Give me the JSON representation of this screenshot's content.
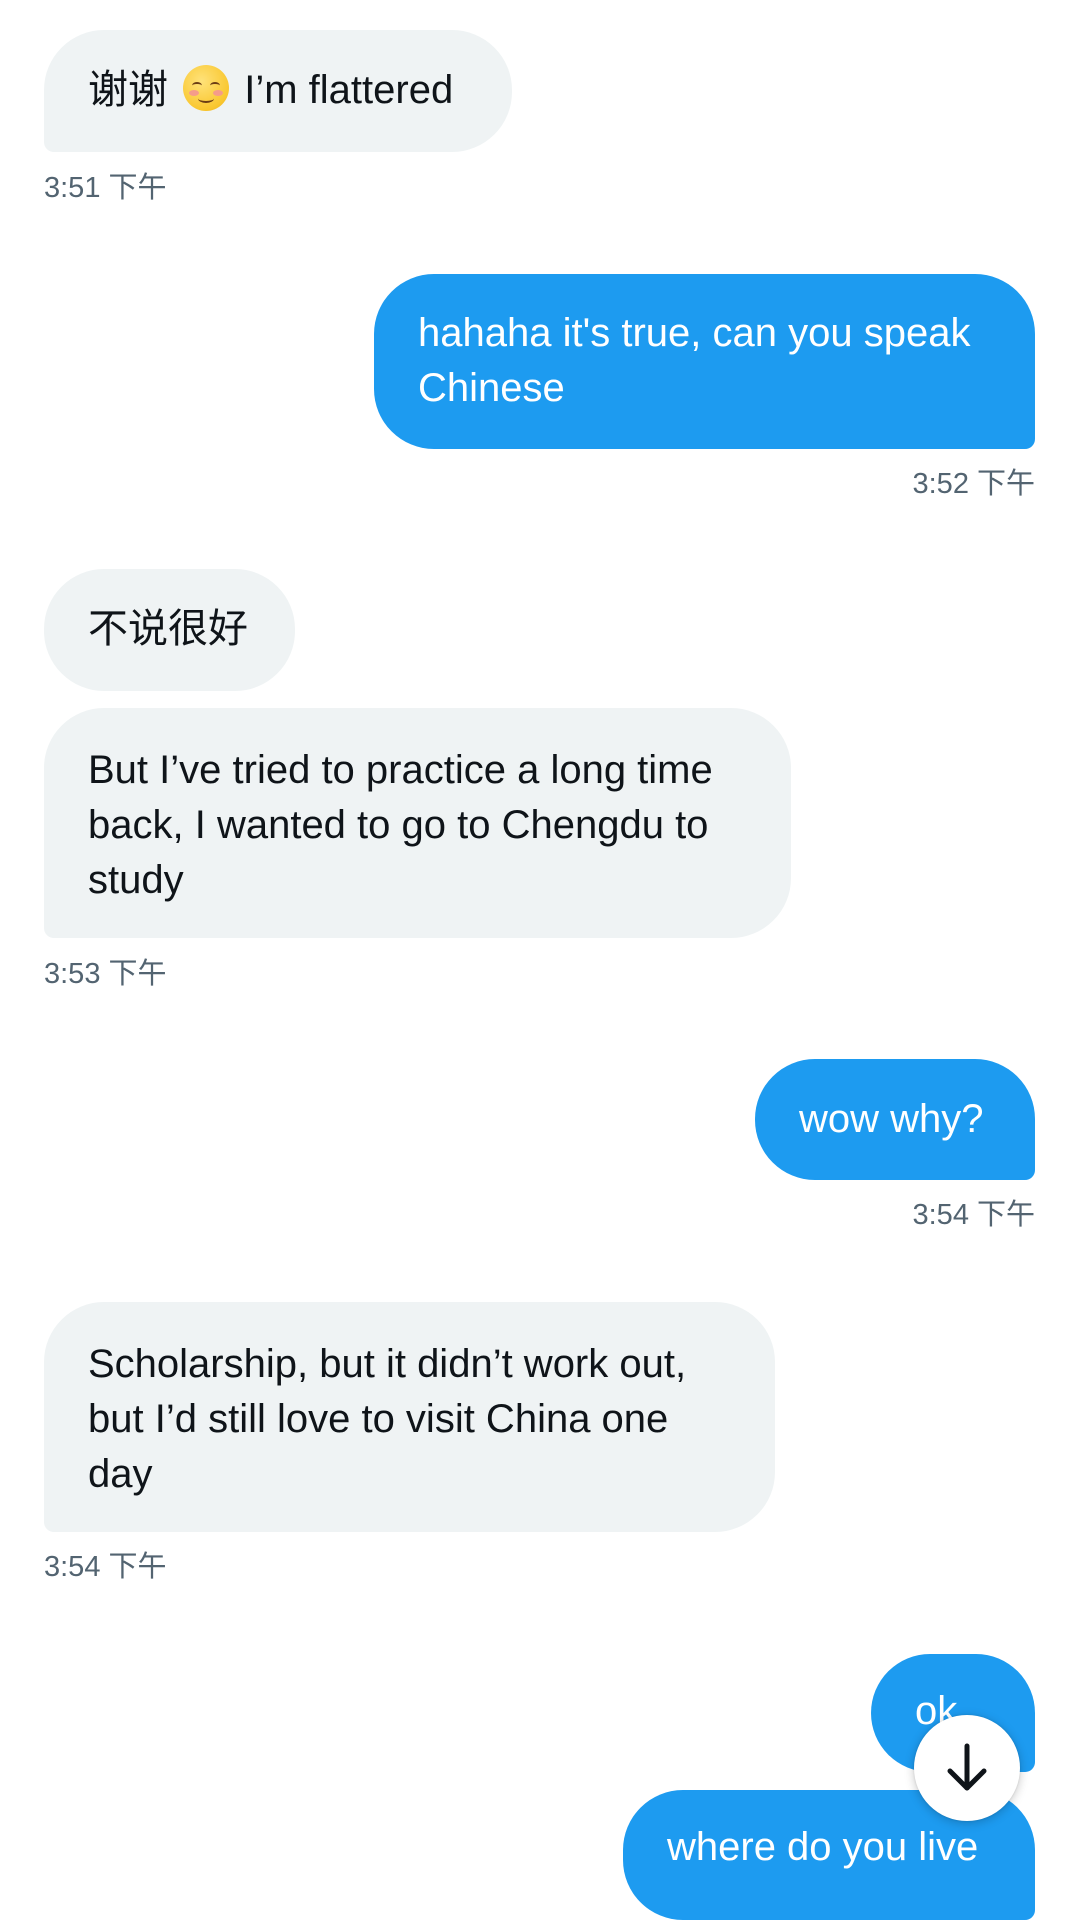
{
  "messages": [
    {
      "id": 1,
      "direction": "received",
      "text_before": "谢谢",
      "emoji": "smiling-face-icon",
      "text_after": "I’m flattered",
      "time": "3:51 下午"
    },
    {
      "id": 2,
      "direction": "sent",
      "text": "hahaha it's true, can you speak Chinese",
      "time": "3:52 下午"
    },
    {
      "id": 3,
      "direction": "received",
      "text": "不说很好"
    },
    {
      "id": 4,
      "direction": "received",
      "text": "But I’ve tried to practice a long time back, I wanted to go to Chengdu to study",
      "time": "3:53 下午"
    },
    {
      "id": 5,
      "direction": "sent",
      "text": "wow why?",
      "time": "3:54 下午"
    },
    {
      "id": 6,
      "direction": "received",
      "text": "Scholarship, but it didn’t work out, but I’d still love to visit China one day",
      "time": "3:54 下午"
    },
    {
      "id": 7,
      "direction": "sent",
      "text": "ok"
    },
    {
      "id": 8,
      "direction": "sent",
      "text": "where do you live"
    }
  ],
  "scroll_button": {
    "icon": "arrow-down-icon"
  },
  "colors": {
    "sent_bubble": "#1d9bf0",
    "received_bubble": "#eff3f4",
    "timestamp": "#536471",
    "text_dark": "#0f1419"
  }
}
